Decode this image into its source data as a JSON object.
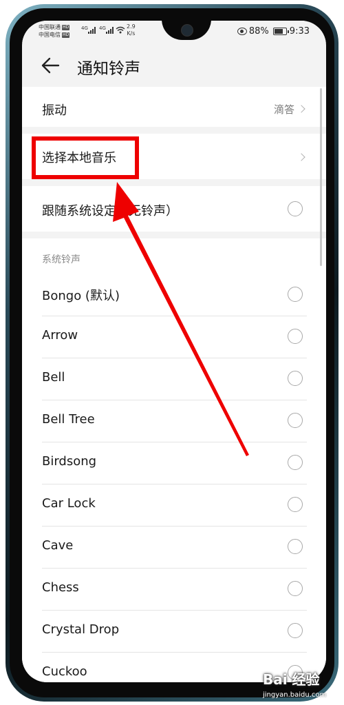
{
  "status_bar": {
    "carrier1": "中国联通",
    "carrier2": "中国电信",
    "hd_badge": "HD",
    "signal1": "4G",
    "signal2": "4G",
    "speed_value": "2.9",
    "speed_unit": "K/s",
    "battery": "88%",
    "time": "9:33"
  },
  "header": {
    "title": "通知铃声"
  },
  "rows": {
    "vibrate_label": "振动",
    "vibrate_value": "滴答",
    "local_music_label": "选择本地音乐",
    "follow_system_label": "跟随系统设定（无铃声）"
  },
  "section": {
    "system_ringtones_label": "系统铃声"
  },
  "ringtones": [
    "Bongo (默认)",
    "Arrow",
    "Bell",
    "Bell Tree",
    "Birdsong",
    "Car Lock",
    "Cave",
    "Chess",
    "Crystal Drop",
    "Cuckoo"
  ],
  "watermark": {
    "brand": "Bai 经验",
    "url": "jingyan.baidu.com"
  },
  "colors": {
    "annotation_red": "#ee0000",
    "screen_bg": "#f3f3f3"
  }
}
